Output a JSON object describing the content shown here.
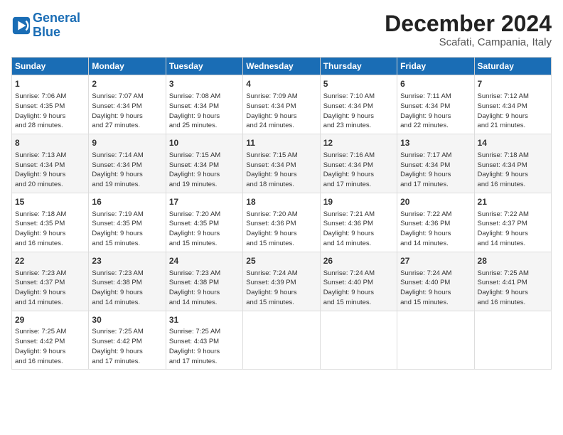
{
  "logo": {
    "line1": "General",
    "line2": "Blue"
  },
  "title": "December 2024",
  "location": "Scafati, Campania, Italy",
  "weekdays": [
    "Sunday",
    "Monday",
    "Tuesday",
    "Wednesday",
    "Thursday",
    "Friday",
    "Saturday"
  ],
  "weeks": [
    [
      {
        "day": "1",
        "info": "Sunrise: 7:06 AM\nSunset: 4:35 PM\nDaylight: 9 hours\nand 28 minutes."
      },
      {
        "day": "2",
        "info": "Sunrise: 7:07 AM\nSunset: 4:34 PM\nDaylight: 9 hours\nand 27 minutes."
      },
      {
        "day": "3",
        "info": "Sunrise: 7:08 AM\nSunset: 4:34 PM\nDaylight: 9 hours\nand 25 minutes."
      },
      {
        "day": "4",
        "info": "Sunrise: 7:09 AM\nSunset: 4:34 PM\nDaylight: 9 hours\nand 24 minutes."
      },
      {
        "day": "5",
        "info": "Sunrise: 7:10 AM\nSunset: 4:34 PM\nDaylight: 9 hours\nand 23 minutes."
      },
      {
        "day": "6",
        "info": "Sunrise: 7:11 AM\nSunset: 4:34 PM\nDaylight: 9 hours\nand 22 minutes."
      },
      {
        "day": "7",
        "info": "Sunrise: 7:12 AM\nSunset: 4:34 PM\nDaylight: 9 hours\nand 21 minutes."
      }
    ],
    [
      {
        "day": "8",
        "info": "Sunrise: 7:13 AM\nSunset: 4:34 PM\nDaylight: 9 hours\nand 20 minutes."
      },
      {
        "day": "9",
        "info": "Sunrise: 7:14 AM\nSunset: 4:34 PM\nDaylight: 9 hours\nand 19 minutes."
      },
      {
        "day": "10",
        "info": "Sunrise: 7:15 AM\nSunset: 4:34 PM\nDaylight: 9 hours\nand 19 minutes."
      },
      {
        "day": "11",
        "info": "Sunrise: 7:15 AM\nSunset: 4:34 PM\nDaylight: 9 hours\nand 18 minutes."
      },
      {
        "day": "12",
        "info": "Sunrise: 7:16 AM\nSunset: 4:34 PM\nDaylight: 9 hours\nand 17 minutes."
      },
      {
        "day": "13",
        "info": "Sunrise: 7:17 AM\nSunset: 4:34 PM\nDaylight: 9 hours\nand 17 minutes."
      },
      {
        "day": "14",
        "info": "Sunrise: 7:18 AM\nSunset: 4:34 PM\nDaylight: 9 hours\nand 16 minutes."
      }
    ],
    [
      {
        "day": "15",
        "info": "Sunrise: 7:18 AM\nSunset: 4:35 PM\nDaylight: 9 hours\nand 16 minutes."
      },
      {
        "day": "16",
        "info": "Sunrise: 7:19 AM\nSunset: 4:35 PM\nDaylight: 9 hours\nand 15 minutes."
      },
      {
        "day": "17",
        "info": "Sunrise: 7:20 AM\nSunset: 4:35 PM\nDaylight: 9 hours\nand 15 minutes."
      },
      {
        "day": "18",
        "info": "Sunrise: 7:20 AM\nSunset: 4:36 PM\nDaylight: 9 hours\nand 15 minutes."
      },
      {
        "day": "19",
        "info": "Sunrise: 7:21 AM\nSunset: 4:36 PM\nDaylight: 9 hours\nand 14 minutes."
      },
      {
        "day": "20",
        "info": "Sunrise: 7:22 AM\nSunset: 4:36 PM\nDaylight: 9 hours\nand 14 minutes."
      },
      {
        "day": "21",
        "info": "Sunrise: 7:22 AM\nSunset: 4:37 PM\nDaylight: 9 hours\nand 14 minutes."
      }
    ],
    [
      {
        "day": "22",
        "info": "Sunrise: 7:23 AM\nSunset: 4:37 PM\nDaylight: 9 hours\nand 14 minutes."
      },
      {
        "day": "23",
        "info": "Sunrise: 7:23 AM\nSunset: 4:38 PM\nDaylight: 9 hours\nand 14 minutes."
      },
      {
        "day": "24",
        "info": "Sunrise: 7:23 AM\nSunset: 4:38 PM\nDaylight: 9 hours\nand 14 minutes."
      },
      {
        "day": "25",
        "info": "Sunrise: 7:24 AM\nSunset: 4:39 PM\nDaylight: 9 hours\nand 15 minutes."
      },
      {
        "day": "26",
        "info": "Sunrise: 7:24 AM\nSunset: 4:40 PM\nDaylight: 9 hours\nand 15 minutes."
      },
      {
        "day": "27",
        "info": "Sunrise: 7:24 AM\nSunset: 4:40 PM\nDaylight: 9 hours\nand 15 minutes."
      },
      {
        "day": "28",
        "info": "Sunrise: 7:25 AM\nSunset: 4:41 PM\nDaylight: 9 hours\nand 16 minutes."
      }
    ],
    [
      {
        "day": "29",
        "info": "Sunrise: 7:25 AM\nSunset: 4:42 PM\nDaylight: 9 hours\nand 16 minutes."
      },
      {
        "day": "30",
        "info": "Sunrise: 7:25 AM\nSunset: 4:42 PM\nDaylight: 9 hours\nand 17 minutes."
      },
      {
        "day": "31",
        "info": "Sunrise: 7:25 AM\nSunset: 4:43 PM\nDaylight: 9 hours\nand 17 minutes."
      },
      {
        "day": "",
        "info": ""
      },
      {
        "day": "",
        "info": ""
      },
      {
        "day": "",
        "info": ""
      },
      {
        "day": "",
        "info": ""
      }
    ]
  ]
}
